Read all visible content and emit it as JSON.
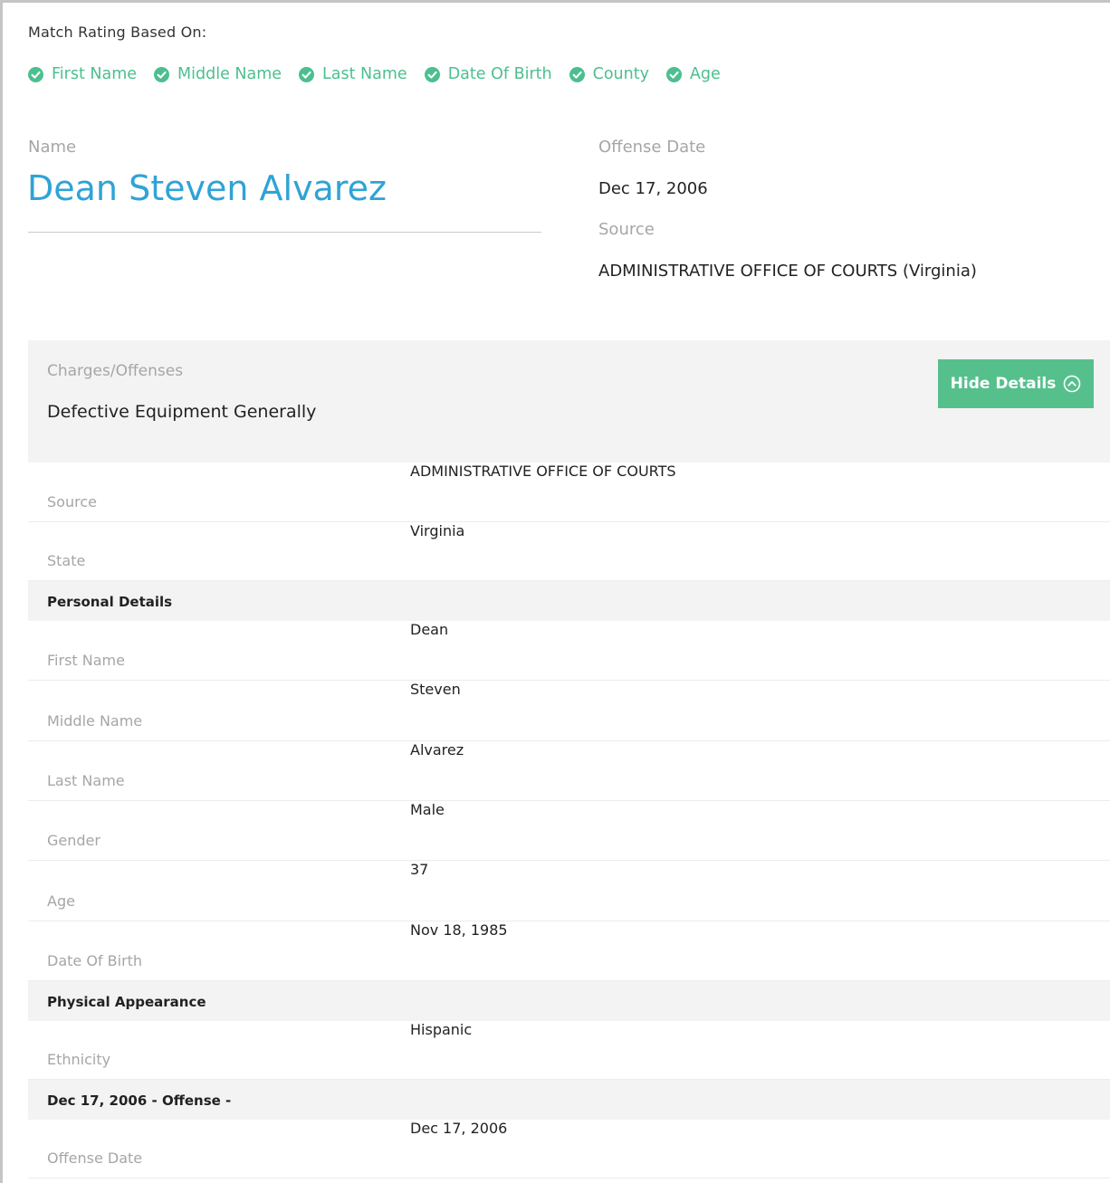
{
  "match": {
    "title": "Match Rating Based On:",
    "criteria": [
      "First Name",
      "Middle Name",
      "Last Name",
      "Date Of Birth",
      "County",
      "Age"
    ],
    "accent_color": "#4cbf8e"
  },
  "record": {
    "name_label": "Name",
    "name": "Dean Steven Alvarez",
    "offense_date_label": "Offense Date",
    "offense_date": "Dec 17, 2006",
    "source_label": "Source",
    "source": "ADMINISTRATIVE OFFICE OF COURTS (Virginia)"
  },
  "charges": {
    "label": "Charges/Offenses",
    "value": "Defective Equipment Generally",
    "hide_button": "Hide Details",
    "button_icon": "chevron-up-circle-icon"
  },
  "details": {
    "source": {
      "label": "Source",
      "value": "ADMINISTRATIVE OFFICE OF COURTS"
    },
    "state": {
      "label": "State",
      "value": "Virginia"
    },
    "personal_heading": "Personal Details",
    "first_name": {
      "label": "First Name",
      "value": "Dean"
    },
    "middle_name": {
      "label": "Middle Name",
      "value": "Steven"
    },
    "last_name": {
      "label": "Last Name",
      "value": "Alvarez"
    },
    "gender": {
      "label": "Gender",
      "value": "Male"
    },
    "age": {
      "label": "Age",
      "value": "37"
    },
    "dob": {
      "label": "Date Of Birth",
      "value": "Nov 18, 1985"
    },
    "physical_heading": "Physical Appearance",
    "ethnicity": {
      "label": "Ethnicity",
      "value": "Hispanic"
    },
    "offense_heading": "Dec 17, 2006 - Offense -",
    "offense_date": {
      "label": "Offense Date",
      "value": "Dec 17, 2006"
    }
  }
}
